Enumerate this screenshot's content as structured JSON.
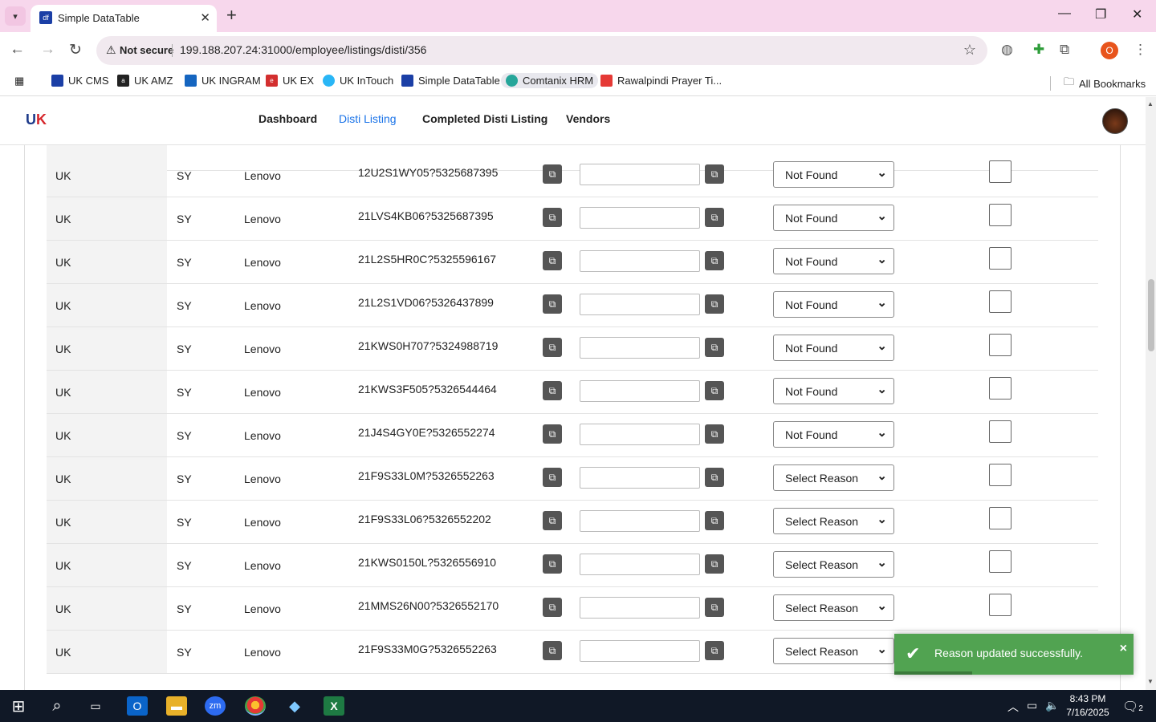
{
  "browser": {
    "tab_title": "Simple DataTable",
    "tab_favicon": "df",
    "not_secure": "Not secure",
    "url": "199.188.207.24:31000/employee/listings/disti/356",
    "profile_initial": "O",
    "bookmarks": [
      {
        "label": "UK CMS",
        "color": "#1b3fa6"
      },
      {
        "label": "UK AMZ",
        "color": "#222222"
      },
      {
        "label": "UK INGRAM",
        "color": "#1565c0"
      },
      {
        "label": "UK EX",
        "color": "#d32f2f"
      },
      {
        "label": "UK InTouch",
        "color": "#29b6f6"
      },
      {
        "label": "Simple DataTable",
        "color": "#1b3fa6"
      },
      {
        "label": "Comtanix HRM",
        "color": "#26a69a"
      },
      {
        "label": "Rawalpindi Prayer Ti...",
        "color": "#e53935"
      }
    ],
    "all_bookmarks": "All Bookmarks"
  },
  "app": {
    "logo_main": "U",
    "logo_accent": "K",
    "nav": [
      "Dashboard",
      "Disti Listing",
      "Completed Disti Listing",
      "Vendors"
    ]
  },
  "table": {
    "rows": [
      {
        "country": "UK",
        "code": "SY",
        "brand": "Lenovo",
        "sku": "12U2S1WY05?5325687395",
        "reason": "Not Found"
      },
      {
        "country": "UK",
        "code": "SY",
        "brand": "Lenovo",
        "sku": "21LVS4KB06?5325687395",
        "reason": "Not Found"
      },
      {
        "country": "UK",
        "code": "SY",
        "brand": "Lenovo",
        "sku": "21L2S5HR0C?5325596167",
        "reason": "Not Found"
      },
      {
        "country": "UK",
        "code": "SY",
        "brand": "Lenovo",
        "sku": "21L2S1VD06?5326437899",
        "reason": "Not Found"
      },
      {
        "country": "UK",
        "code": "SY",
        "brand": "Lenovo",
        "sku": "21KWS0H707?5324988719",
        "reason": "Not Found"
      },
      {
        "country": "UK",
        "code": "SY",
        "brand": "Lenovo",
        "sku": "21KWS3F505?5326544464",
        "reason": "Not Found"
      },
      {
        "country": "UK",
        "code": "SY",
        "brand": "Lenovo",
        "sku": "21J4S4GY0E?5326552274",
        "reason": "Not Found"
      },
      {
        "country": "UK",
        "code": "SY",
        "brand": "Lenovo",
        "sku": "21F9S33L0M?5326552263",
        "reason": "Select Reason"
      },
      {
        "country": "UK",
        "code": "SY",
        "brand": "Lenovo",
        "sku": "21F9S33L06?5326552202",
        "reason": "Select Reason"
      },
      {
        "country": "UK",
        "code": "SY",
        "brand": "Lenovo",
        "sku": "21KWS0150L?5326556910",
        "reason": "Select Reason"
      },
      {
        "country": "UK",
        "code": "SY",
        "brand": "Lenovo",
        "sku": "21MMS26N00?5326552170",
        "reason": "Select Reason"
      },
      {
        "country": "UK",
        "code": "SY",
        "brand": "Lenovo",
        "sku": "21F9S33M0G?5326552263",
        "reason": "Select Reason"
      }
    ]
  },
  "toast": {
    "message": "Reason updated successfully.",
    "close": "×",
    "color": "#51a351"
  },
  "taskbar": {
    "time": "8:43 PM",
    "date": "7/16/2025",
    "notifications": "2"
  }
}
